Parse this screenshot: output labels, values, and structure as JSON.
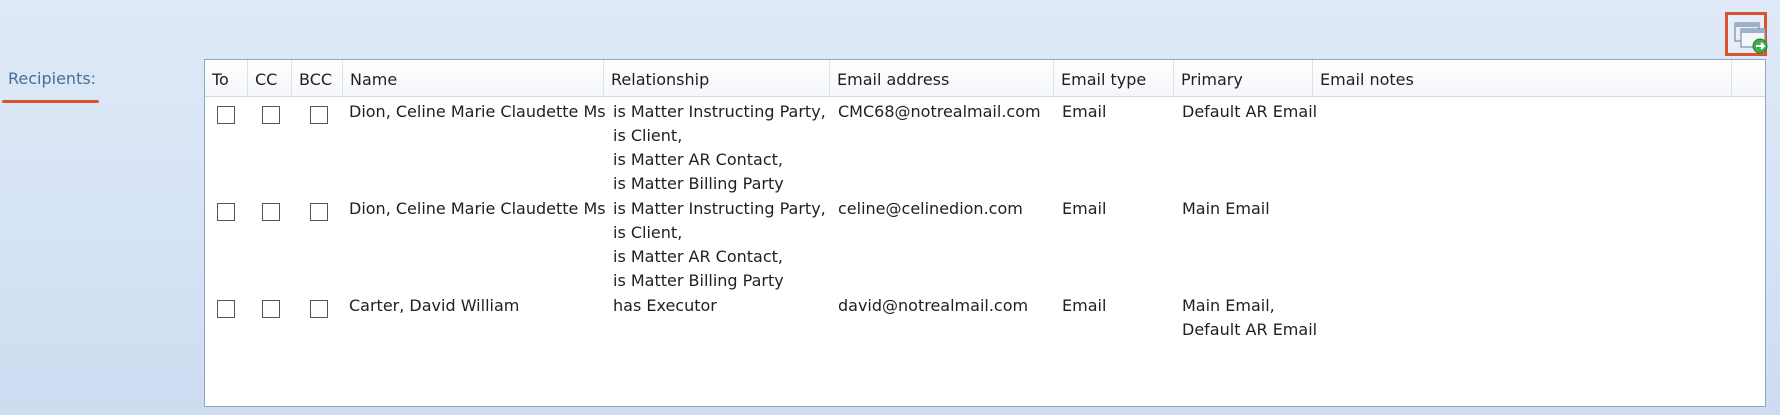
{
  "recipients_label": "Recipients:",
  "columns": {
    "to": "To",
    "cc": "CC",
    "bcc": "BCC",
    "name": "Name",
    "relationship": "Relationship",
    "email_address": "Email address",
    "email_type": "Email type",
    "primary": "Primary",
    "email_notes": "Email notes"
  },
  "rows": [
    {
      "to": false,
      "cc": false,
      "bcc": false,
      "name": "Dion, Celine Marie Claudette Ms",
      "relationship": [
        "is Matter Instructing Party,",
        "is Client,",
        "is Matter AR Contact,",
        "is Matter Billing Party"
      ],
      "email_address": "CMC68@notrealmail.com",
      "email_type": "Email",
      "primary": [
        "Default AR Email"
      ],
      "email_notes": ""
    },
    {
      "to": false,
      "cc": false,
      "bcc": false,
      "name": "Dion, Celine Marie Claudette Ms",
      "relationship": [
        "is Matter Instructing Party,",
        "is Client,",
        "is Matter AR Contact,",
        "is Matter Billing Party"
      ],
      "email_address": "celine@celinedion.com",
      "email_type": "Email",
      "primary": [
        "Main Email"
      ],
      "email_notes": ""
    },
    {
      "to": false,
      "cc": false,
      "bcc": false,
      "name": "Carter, David William",
      "relationship": [
        "has Executor"
      ],
      "email_address": "david@notrealmail.com",
      "email_type": "Email",
      "primary": [
        "Main Email,",
        "Default AR Email"
      ],
      "email_notes": ""
    }
  ],
  "icons": {
    "add_recipient": "window-add-icon"
  },
  "colors": {
    "highlight": "#d9532b",
    "label": "#4a6c96",
    "grid_border": "#8fa6c4"
  }
}
